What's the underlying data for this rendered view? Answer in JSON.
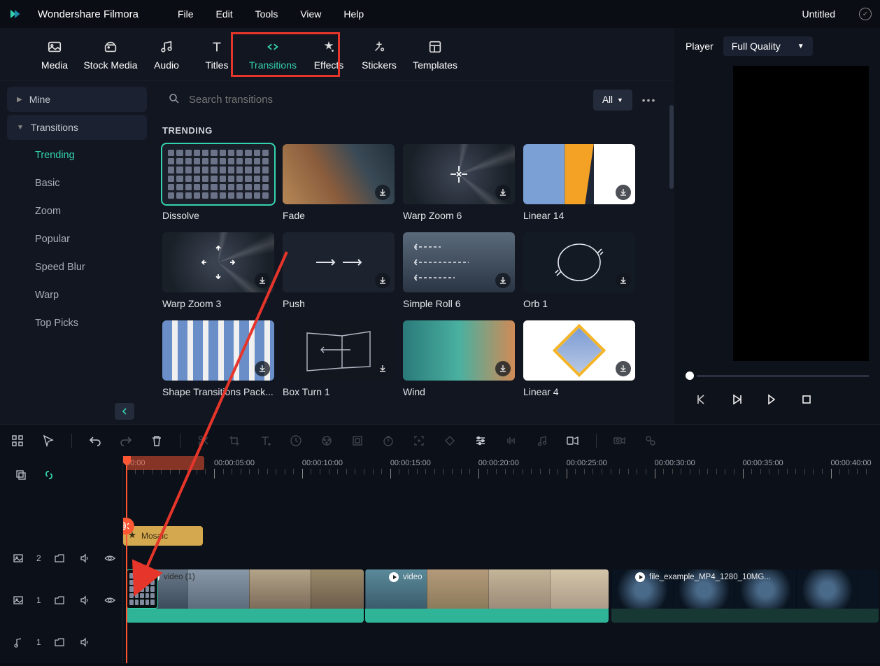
{
  "app_name": "Wondershare Filmora",
  "document_title": "Untitled",
  "menus": [
    "File",
    "Edit",
    "Tools",
    "View",
    "Help"
  ],
  "tabs": [
    {
      "label": "Media"
    },
    {
      "label": "Stock Media"
    },
    {
      "label": "Audio"
    },
    {
      "label": "Titles"
    },
    {
      "label": "Transitions"
    },
    {
      "label": "Effects"
    },
    {
      "label": "Stickers"
    },
    {
      "label": "Templates"
    }
  ],
  "sidebar": {
    "mine": "Mine",
    "transitions_head": "Transitions",
    "items": [
      "Trending",
      "Basic",
      "Zoom",
      "Popular",
      "Speed Blur",
      "Warp",
      "Top Picks"
    ]
  },
  "search": {
    "placeholder": "Search transitions",
    "all_label": "All"
  },
  "section": "TRENDING",
  "cards": [
    {
      "label": "Dissolve",
      "selected": true,
      "dl": false
    },
    {
      "label": "Fade",
      "dl": true
    },
    {
      "label": "Warp Zoom 6",
      "dl": true
    },
    {
      "label": "Linear 14",
      "dl": true
    },
    {
      "label": "Warp Zoom 3",
      "dl": true
    },
    {
      "label": "Push",
      "dl": true
    },
    {
      "label": "Simple Roll 6",
      "dl": true
    },
    {
      "label": "Orb 1",
      "dl": true
    },
    {
      "label": "Shape Transitions Pack...",
      "dl": true
    },
    {
      "label": "Box Turn 1",
      "dl": true
    },
    {
      "label": "Wind",
      "dl": true
    },
    {
      "label": "Linear 4",
      "dl": true
    }
  ],
  "preview": {
    "player_label": "Player",
    "quality_label": "Full Quality"
  },
  "ruler": [
    "00:00",
    "00:00:05:00",
    "00:00:10:00",
    "00:00:15:00",
    "00:00:20:00",
    "00:00:25:00",
    "00:00:30:00",
    "00:00:35:00",
    "00:00:40:00"
  ],
  "tracks": {
    "image_track": "2",
    "video_track": "1",
    "audio_track": "1",
    "mosaic_label": "Mosaic",
    "clip1_label": "video (1)",
    "clip2_label": "video",
    "clip3_label": "file_example_MP4_1280_10MG..."
  }
}
